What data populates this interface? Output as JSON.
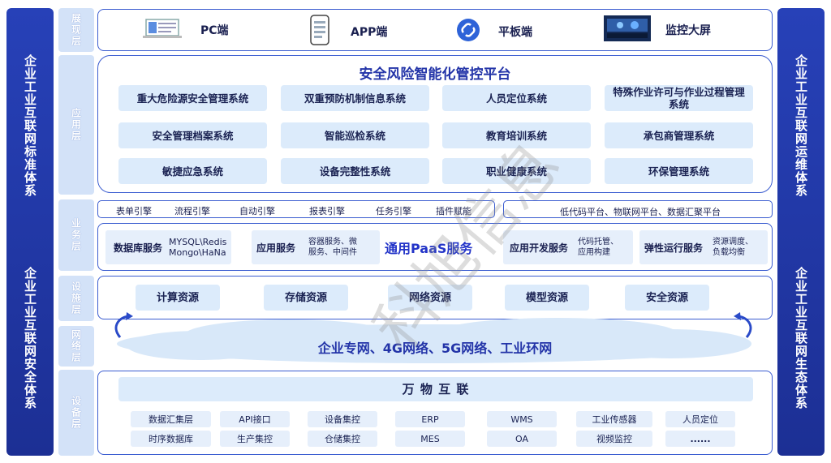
{
  "side_left": [
    "企业工业互联网标准体系",
    "企业工业互联网安全体系"
  ],
  "side_right": [
    "企业工业互联网运维体系",
    "企业工业互联网生态体系"
  ],
  "layers": [
    "展现层",
    "应用层",
    "业务层",
    "设施层",
    "网络层",
    "设备层"
  ],
  "presentation": [
    {
      "label": "PC端",
      "icon": "laptop-icon"
    },
    {
      "label": "APP端",
      "icon": "phone-icon"
    },
    {
      "label": "平板端",
      "icon": "link-icon"
    },
    {
      "label": "监控大屏",
      "icon": "monitor-wall-icon"
    }
  ],
  "platform_title": "安全风险智能化管控平台",
  "apps": [
    "重大危险源安全管理系统",
    "双重预防机制信息系统",
    "人员定位系统",
    "特殊作业许可与作业过程管理系统",
    "安全管理档案系统",
    "智能巡检系统",
    "教育培训系统",
    "承包商管理系统",
    "敏捷应急系统",
    "设备完整性系统",
    "职业健康系统",
    "环保管理系统"
  ],
  "engines": [
    "表单引擎",
    "流程引擎",
    "自动引擎",
    "报表引擎",
    "任务引擎",
    "插件赋能"
  ],
  "platforms_text": "低代码平台、物联网平台、数据汇聚平台",
  "services": {
    "db": {
      "name": "数据库服务",
      "desc1": "MYSQL\\Redis",
      "desc2": "Mongo\\HaNa"
    },
    "app": {
      "name": "应用服务",
      "desc1": "容器服务、微",
      "desc2": "服务、中间件"
    },
    "center": "通用PaaS服务",
    "dev": {
      "name": "应用开发服务",
      "desc1": "代码托管、",
      "desc2": "应用构建"
    },
    "ops": {
      "name": "弹性运行服务",
      "desc1": "资源调度、",
      "desc2": "负载均衡"
    }
  },
  "resources": [
    "计算资源",
    "存储资源",
    "网络资源",
    "模型资源",
    "安全资源"
  ],
  "network": "企业专网、4G网络、5G网络、工业环网",
  "iot_title": "万 物 互 联",
  "devices_row1": [
    "数据汇集层",
    "API接口",
    "设备集控",
    "ERP",
    "WMS",
    "工业传感器",
    "人员定位"
  ],
  "devices_row2": [
    "时序数据库",
    "生产集控",
    "仓储集控",
    "MES",
    "OA",
    "视频监控",
    "......"
  ],
  "watermark": "科旭信息"
}
